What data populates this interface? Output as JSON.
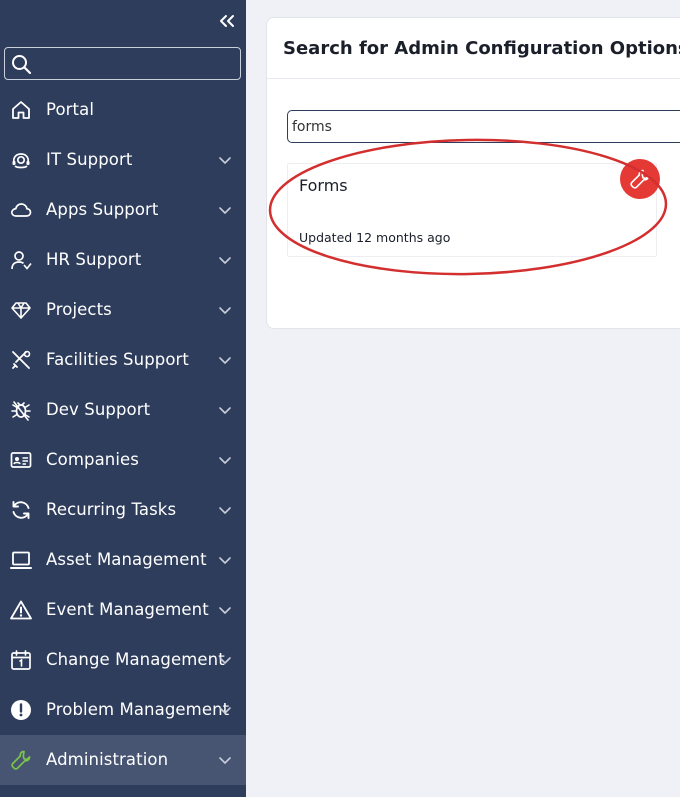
{
  "sidebar": {
    "search_placeholder": "",
    "items": [
      {
        "label": "Portal",
        "icon": "home-icon",
        "has_chevron": false
      },
      {
        "label": "IT Support",
        "icon": "it-support-icon",
        "has_chevron": true
      },
      {
        "label": "Apps Support",
        "icon": "cloud-icon",
        "has_chevron": true
      },
      {
        "label": "HR Support",
        "icon": "user-icon",
        "has_chevron": true
      },
      {
        "label": "Projects",
        "icon": "diamond-icon",
        "has_chevron": true
      },
      {
        "label": "Facilities Support",
        "icon": "tools-icon",
        "has_chevron": true
      },
      {
        "label": "Dev Support",
        "icon": "bug-icon",
        "has_chevron": true
      },
      {
        "label": "Companies",
        "icon": "id-card-icon",
        "has_chevron": true
      },
      {
        "label": "Recurring Tasks",
        "icon": "refresh-icon",
        "has_chevron": true
      },
      {
        "label": "Asset Management",
        "icon": "laptop-icon",
        "has_chevron": true
      },
      {
        "label": "Event Management",
        "icon": "warning-icon",
        "has_chevron": true
      },
      {
        "label": "Change Management",
        "icon": "calendar-icon",
        "has_chevron": true
      },
      {
        "label": "Problem Management",
        "icon": "exclamation-circle-icon",
        "has_chevron": true
      },
      {
        "label": "Administration",
        "icon": "wrench-icon",
        "has_chevron": true,
        "active": true
      }
    ]
  },
  "main": {
    "title": "Search for Admin Configuration Options",
    "search_value": "forms",
    "results": [
      {
        "title": "Forms",
        "updated": "Updated 12 months ago",
        "badge_icon": "wrench-icon"
      }
    ]
  },
  "colors": {
    "sidebar_bg": "#2f3d5c",
    "active_item_bg": "#475572",
    "active_icon": "#7bc44b",
    "badge_red": "#e53935",
    "annotation_red": "#d32f2f",
    "page_bg": "#eff1f6"
  }
}
